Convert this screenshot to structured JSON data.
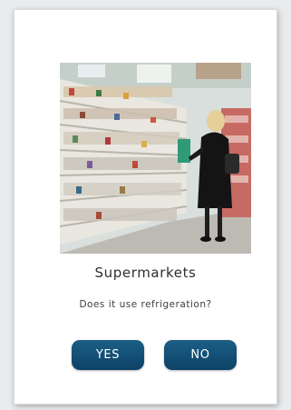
{
  "card": {
    "title": "Supermarkets",
    "question": "Does it use refrigeration?",
    "image_subject": "supermarket-refrigerated-aisle"
  },
  "buttons": {
    "yes_label": "YES",
    "no_label": "NO"
  },
  "colors": {
    "button_bg": "#134f76",
    "button_text": "#ffffff",
    "card_bg": "#ffffff",
    "page_bg": "#e9ebed"
  }
}
